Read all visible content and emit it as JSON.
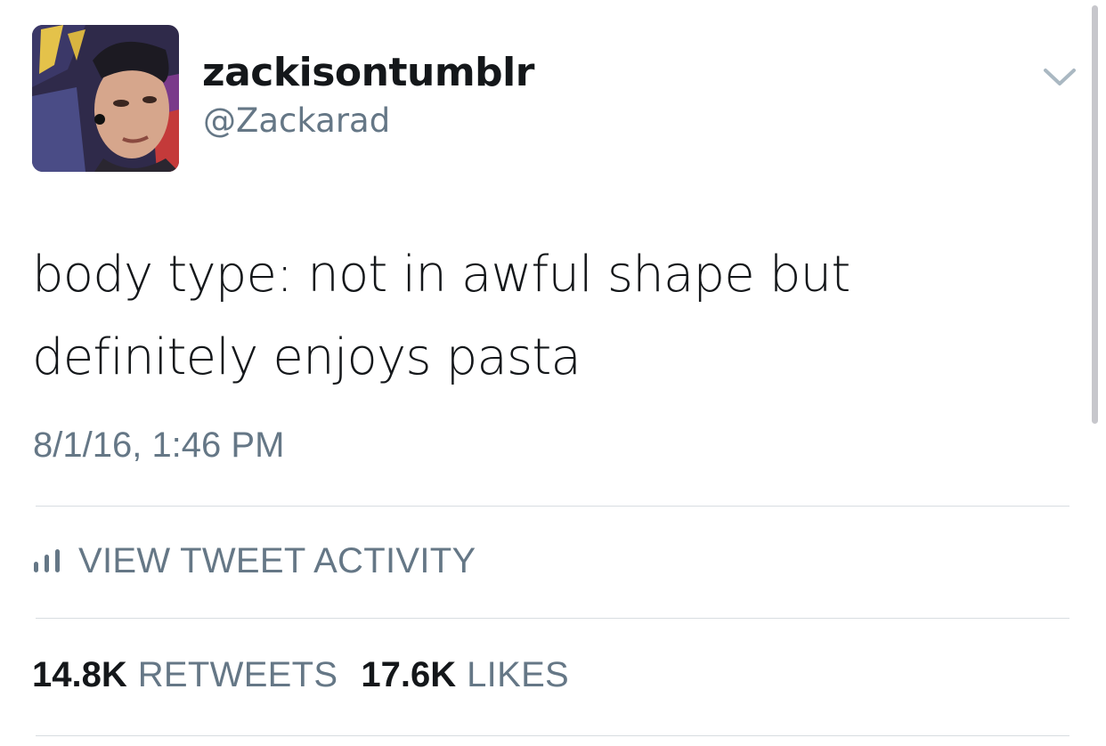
{
  "tweet": {
    "display_name": "zackisontumblr",
    "handle": "@Zackarad",
    "text_line1": "body type: not in awful shape but",
    "text_line2": "definitely enjoys pasta",
    "timestamp": "8/1/16, 1:46 PM"
  },
  "activity": {
    "label": "VIEW TWEET ACTIVITY",
    "icon": "bar-chart-icon"
  },
  "stats": {
    "retweets_count": "14.8K",
    "retweets_label": "RETWEETS",
    "likes_count": "17.6K",
    "likes_label": "LIKES"
  },
  "icons": {
    "menu": "chevron-down-icon",
    "avatar": "avatar-photo"
  },
  "colors": {
    "text_primary": "#14171a",
    "text_secondary": "#657786",
    "divider": "#d8dde1",
    "background": "#ffffff"
  }
}
